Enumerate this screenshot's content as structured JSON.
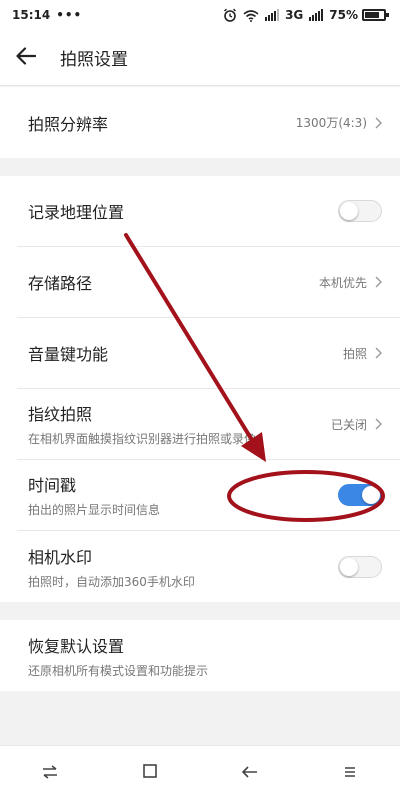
{
  "status_bar": {
    "time": "15:14",
    "dots": "•••",
    "network": "3G",
    "battery_percent": "75%",
    "battery_level": 0.75
  },
  "header": {
    "title": "拍照设置"
  },
  "resolution": {
    "label": "拍照分辨率",
    "value": "1300万(4:3)"
  },
  "settings": {
    "location": {
      "label": "记录地理位置",
      "enabled": false
    },
    "storage": {
      "label": "存储路径",
      "value": "本机优先"
    },
    "volume_key": {
      "label": "音量键功能",
      "value": "拍照"
    },
    "fingerprint": {
      "label": "指纹拍照",
      "sub": "在相机界面触摸指纹识别器进行拍照或录像",
      "value": "已关闭"
    },
    "timestamp": {
      "label": "时间戳",
      "sub": "拍出的照片显示时间信息",
      "enabled": true
    },
    "watermark": {
      "label": "相机水印",
      "sub": "拍照时，自动添加360手机水印",
      "enabled": false
    }
  },
  "reset": {
    "label": "恢复默认设置",
    "sub": "还原相机所有模式设置和功能提示"
  },
  "colors": {
    "accent": "#3b87e6",
    "annotation": "#a3111a",
    "background": "#f2f2f2"
  }
}
